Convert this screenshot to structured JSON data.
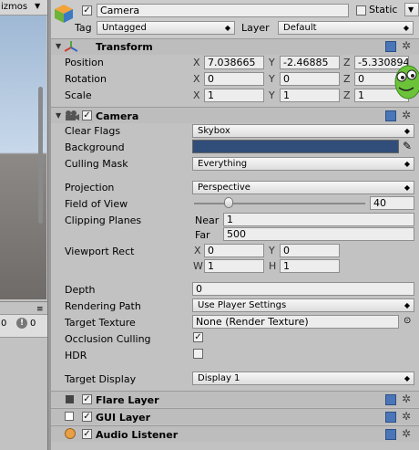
{
  "scene": {
    "gizmos_label": "izmos",
    "gizmos_arrow": "▼",
    "menu_icon": "≡",
    "count_1": "0",
    "badge": "!",
    "count_2": "0"
  },
  "header": {
    "object_name": "Camera",
    "static_label": "Static",
    "static_arrow": "▼",
    "tag_label": "Tag",
    "tag_value": "Untagged",
    "layer_label": "Layer",
    "layer_value": "Default"
  },
  "transform": {
    "title": "Transform",
    "position_label": "Position",
    "rotation_label": "Rotation",
    "scale_label": "Scale",
    "axes": [
      "X",
      "Y",
      "Z"
    ],
    "position": [
      "7.038665",
      "-2.46885",
      "-5.330894"
    ],
    "rotation": [
      "0",
      "0",
      "0"
    ],
    "scale": [
      "1",
      "1",
      "1"
    ]
  },
  "camera": {
    "title": "Camera",
    "clear_flags_label": "Clear Flags",
    "clear_flags_value": "Skybox",
    "background_label": "Background",
    "background_color": "#314d79",
    "culling_mask_label": "Culling Mask",
    "culling_mask_value": "Everything",
    "projection_label": "Projection",
    "projection_value": "Perspective",
    "fov_label": "Field of View",
    "fov_value": "40",
    "fov_fraction": 0.2,
    "clipping_label": "Clipping Planes",
    "near_label": "Near",
    "near_value": "1",
    "far_label": "Far",
    "far_value": "500",
    "viewport_label": "Viewport Rect",
    "viewport_x_label": "X",
    "viewport_x": "0",
    "viewport_y_label": "Y",
    "viewport_y": "0",
    "viewport_w_label": "W",
    "viewport_w": "1",
    "viewport_h_label": "H",
    "viewport_h": "1",
    "depth_label": "Depth",
    "depth_value": "0",
    "rendering_path_label": "Rendering Path",
    "rendering_path_value": "Use Player Settings",
    "target_texture_label": "Target Texture",
    "target_texture_value": "None (Render Texture)",
    "occlusion_label": "Occlusion Culling",
    "occlusion_checked": true,
    "hdr_label": "HDR",
    "hdr_checked": false,
    "target_display_label": "Target Display",
    "target_display_value": "Display 1"
  },
  "components": {
    "flare_layer": "Flare Layer",
    "gui_layer": "GUI Layer",
    "audio_listener": "Audio Listener"
  },
  "icons": {
    "book": "help-book-icon",
    "gear": "gear-icon",
    "dropdown": "▾",
    "dropdown_up_down": "◆"
  }
}
